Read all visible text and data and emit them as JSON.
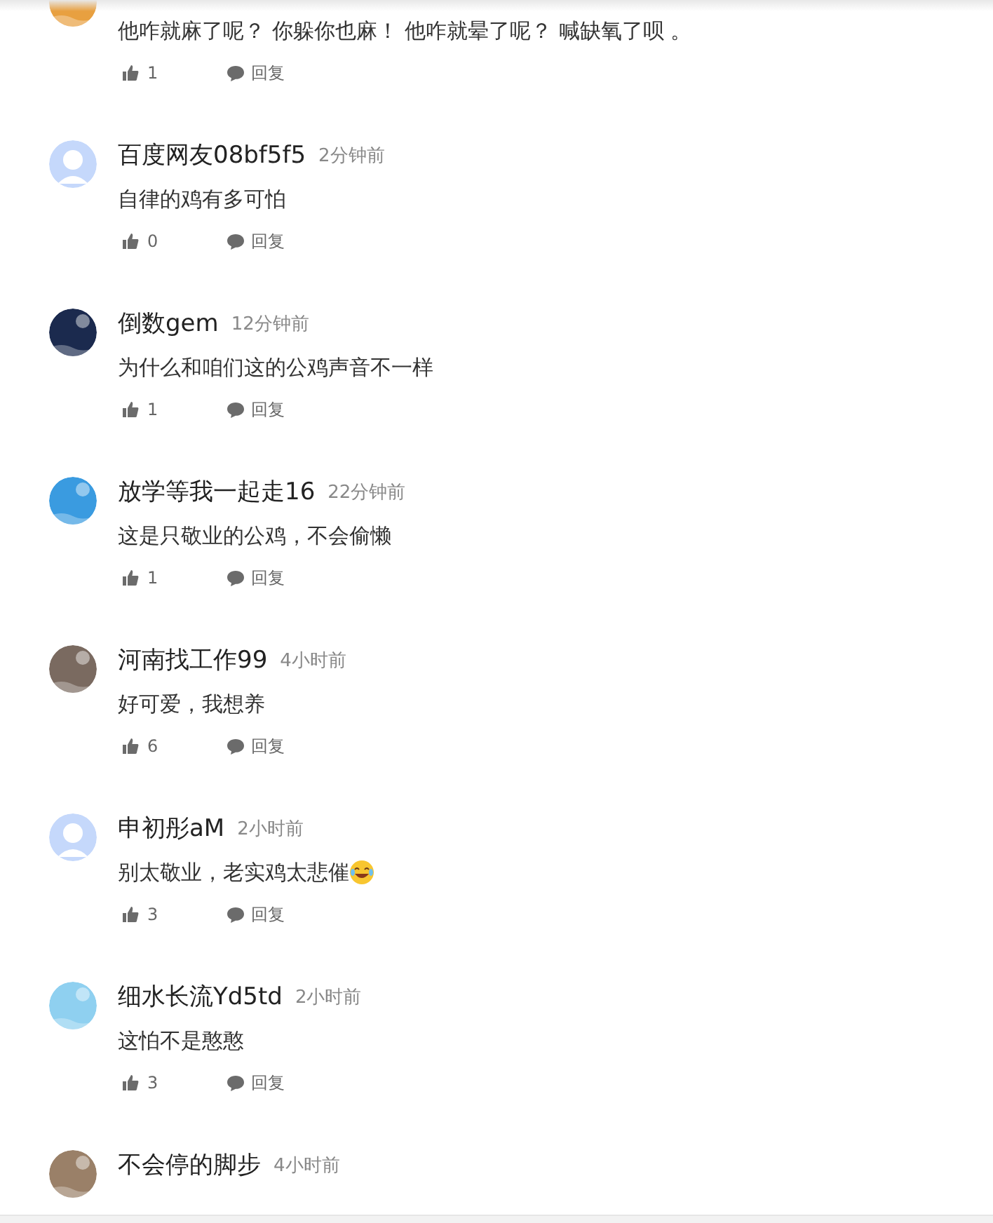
{
  "comments": [
    {
      "text": "他咋就麻了呢？ 你躲你也麻！ 他咋就晕了呢？ 喊缺氧了呗 。",
      "likes": "1",
      "reply": "回复"
    },
    {
      "avatar": {
        "kind": "default",
        "color": "#c5d8fb"
      },
      "name": "百度网友08bf5f5",
      "time": "2分钟前",
      "text": "自律的鸡有多可怕",
      "likes": "0",
      "reply": "回复"
    },
    {
      "name": "倒数gem",
      "time": "12分钟前",
      "text": "为什么和咱们这的公鸡声音不一样",
      "likes": "1",
      "reply": "回复"
    },
    {
      "name": "放学等我一起走16",
      "time": "22分钟前",
      "text": "这是只敬业的公鸡，不会偷懒",
      "likes": "1",
      "reply": "回复"
    },
    {
      "name": "河南找工作99",
      "time": "4小时前",
      "text": "好可爱，我想养",
      "likes": "6",
      "reply": "回复"
    },
    {
      "avatar": {
        "kind": "default",
        "color": "#c5d8fb"
      },
      "name": "申初彤aM",
      "time": "2小时前",
      "text": "别太敬业，老实鸡太悲催",
      "emoji": true,
      "likes": "3",
      "reply": "回复"
    },
    {
      "name": "细水长流Yd5td",
      "time": "2小时前",
      "text": "这怕不是憨憨",
      "likes": "3",
      "reply": "回复"
    },
    {
      "name": "不会停的脚步",
      "time": "4小时前"
    }
  ]
}
